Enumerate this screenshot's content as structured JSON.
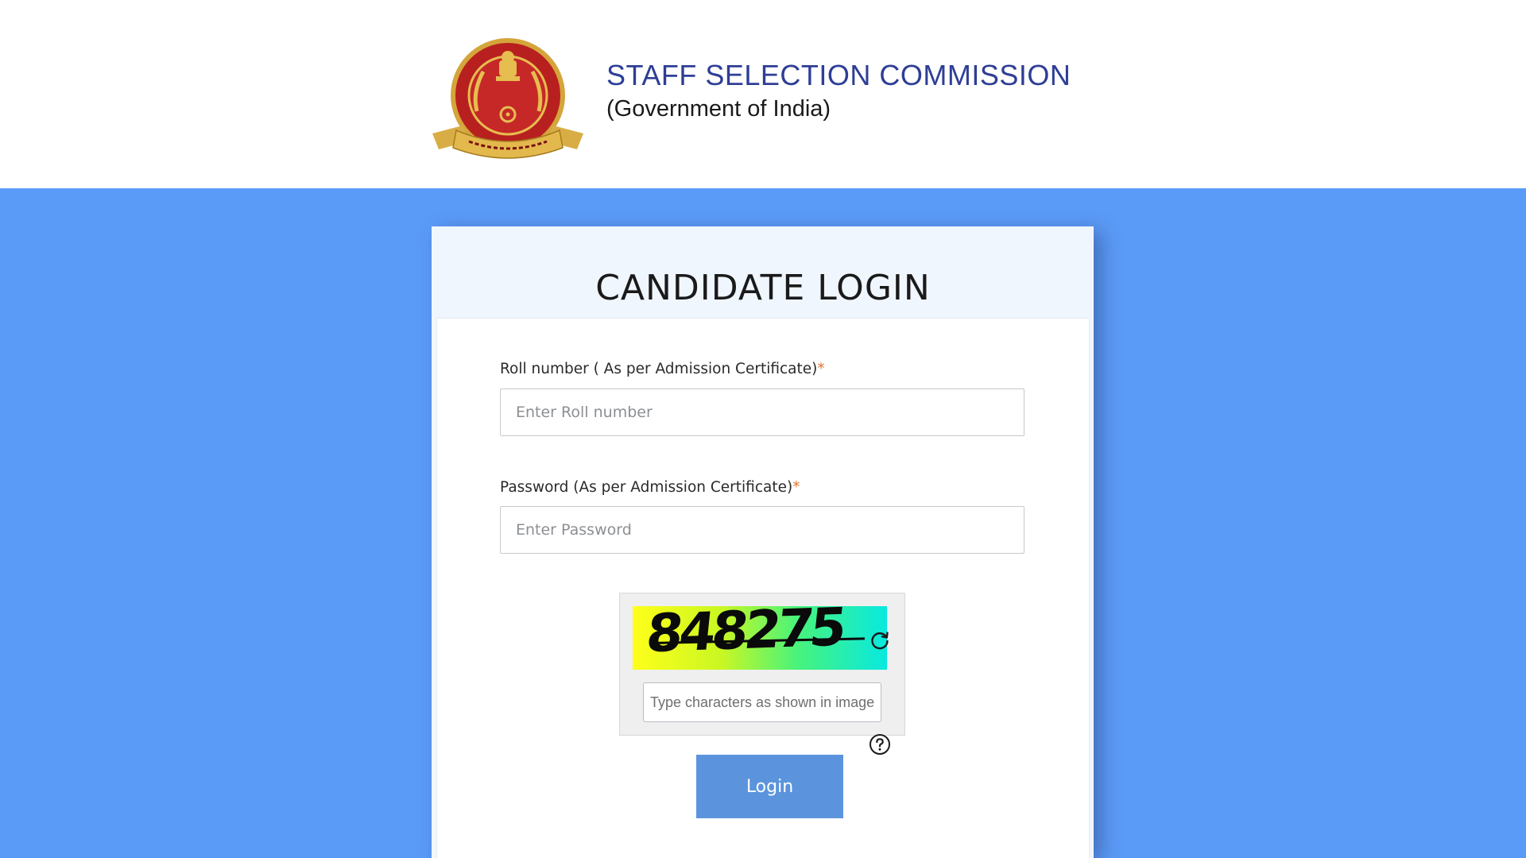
{
  "header": {
    "logo": "ssc-emblem",
    "title": "STAFF SELECTION COMMISSION",
    "subtitle": "(Government of India)"
  },
  "login": {
    "title": "CANDIDATE LOGIN",
    "roll": {
      "label": "Roll number ( As per Admission Certificate)",
      "required_mark": "*",
      "placeholder": "Enter Roll number",
      "value": ""
    },
    "password": {
      "label": "Password (As per Admission Certificate)",
      "required_mark": "*",
      "placeholder": "Enter Password",
      "value": ""
    },
    "captcha": {
      "code": "848275",
      "refresh_icon": "refresh-icon",
      "placeholder": "Type characters as shown in image",
      "value": "",
      "help_icon": "help-icon"
    },
    "submit_label": "Login"
  },
  "colors": {
    "page_background": "#5b9bf8",
    "title_blue": "#2e3e96",
    "button": "#5b94dc",
    "required": "#e5732b"
  }
}
